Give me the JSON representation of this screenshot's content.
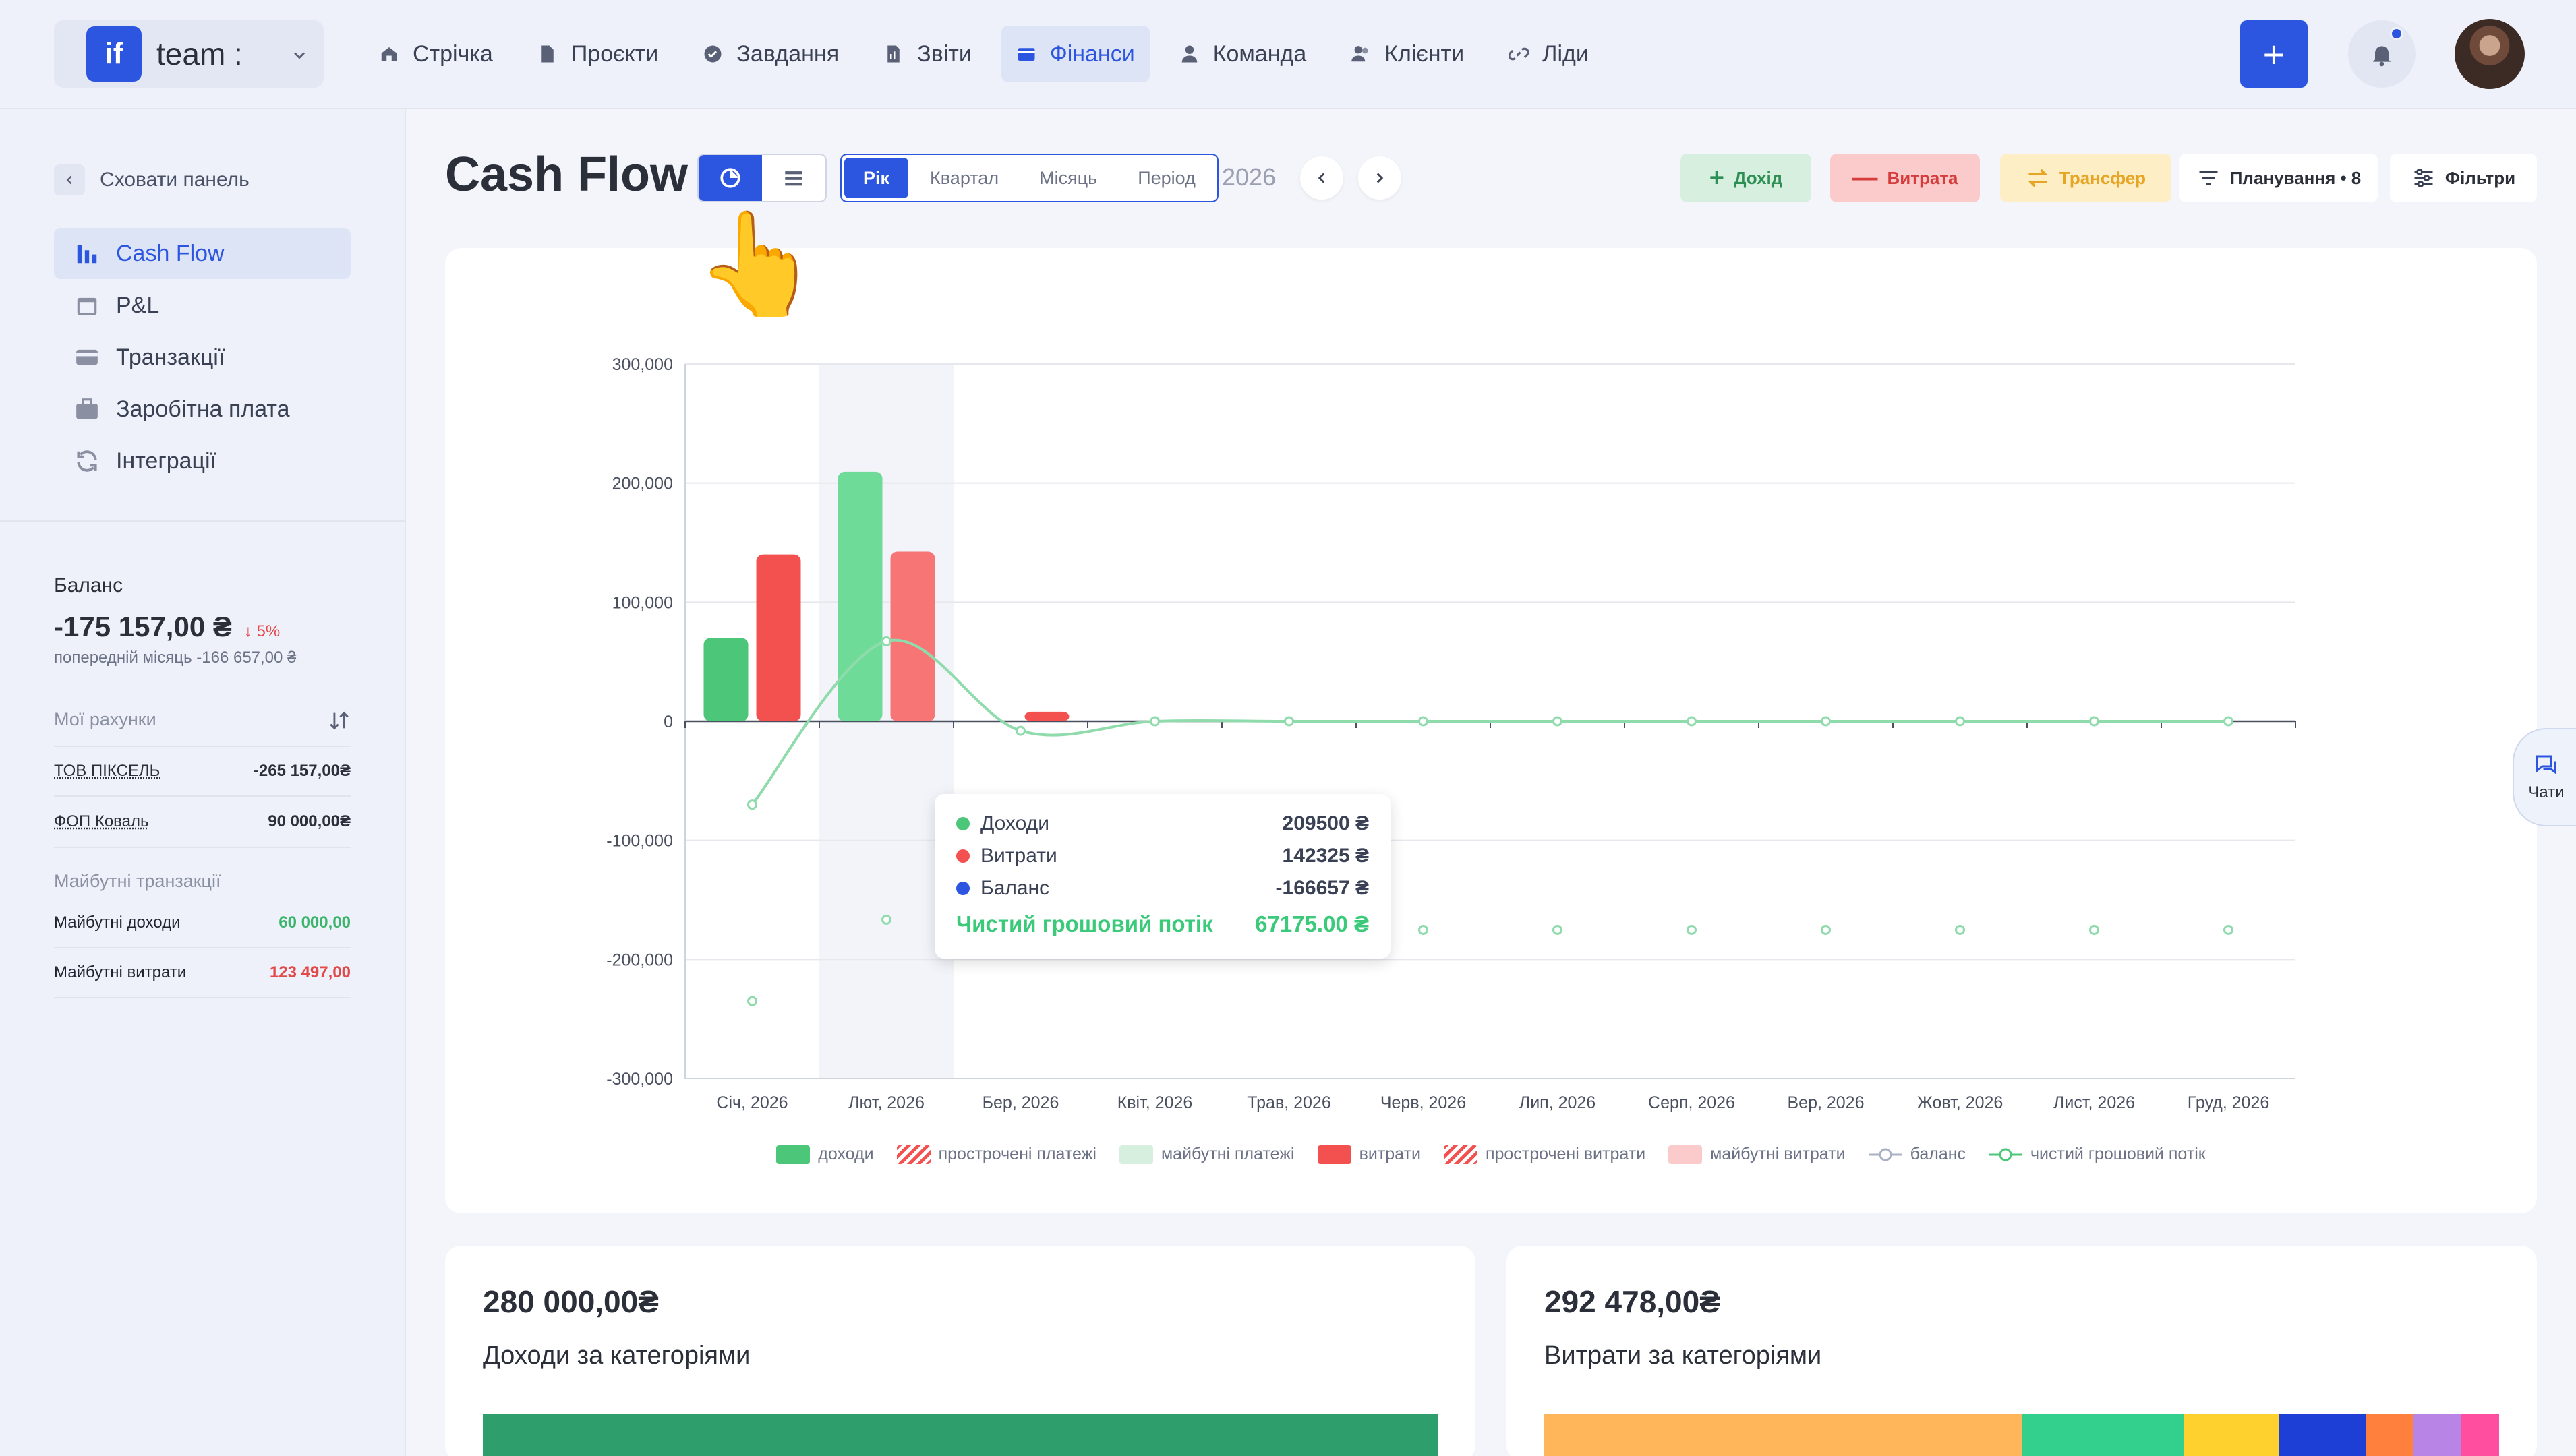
{
  "brand": {
    "logo": "if",
    "name": "team :"
  },
  "nav": [
    {
      "label": "Стрічка",
      "icon": "home-icon"
    },
    {
      "label": "Проєкти",
      "icon": "file-icon"
    },
    {
      "label": "Завдання",
      "icon": "check-circle-icon"
    },
    {
      "label": "Звіти",
      "icon": "report-icon"
    },
    {
      "label": "Фінанси",
      "icon": "wallet-icon",
      "active": true
    },
    {
      "label": "Команда",
      "icon": "user-icon"
    },
    {
      "label": "Клієнти",
      "icon": "users-icon"
    },
    {
      "label": "Ліди",
      "icon": "link-icon"
    }
  ],
  "topbar": {
    "plus": "+"
  },
  "sidebar": {
    "hide_label": "Сховати панель",
    "items": [
      {
        "label": "Cash Flow",
        "active": true
      },
      {
        "label": "P&L"
      },
      {
        "label": "Транзакції"
      },
      {
        "label": "Заробітна плата"
      },
      {
        "label": "Інтеграції"
      }
    ],
    "balance": {
      "title": "Баланс",
      "value": "-175 157,00 ₴",
      "change": "5%",
      "prev": "попередній місяць -166 657,00 ₴"
    },
    "accounts_title": "Мої рахунки",
    "accounts": [
      {
        "name": "ТОВ ПІКСЕЛЬ",
        "value": "-265 157,00₴"
      },
      {
        "name": "ФОП Коваль",
        "value": "90 000,00₴"
      }
    ],
    "future_title": "Майбутні транзакції",
    "future": [
      {
        "name": "Майбутні доходи",
        "value": "60 000,00"
      },
      {
        "name": "Майбутні витрати",
        "value": "123 497,00"
      }
    ]
  },
  "page": {
    "title": "Cash Flow",
    "period_tabs": [
      "Рік",
      "Квартал",
      "Місяць",
      "Період"
    ],
    "year": "2026",
    "actions": {
      "income": "Дохід",
      "expense": "Витрата",
      "transfer": "Трансфер",
      "planning": "Планування • 8",
      "filters": "Фільтри"
    },
    "hand": "👆"
  },
  "colors": {
    "accent": "#2d56e0",
    "income": "#4cc779",
    "expense": "#f35050",
    "balance": "#3f6ff0",
    "netflow": "#3bc97a"
  },
  "chart_data": {
    "type": "bar",
    "categories": [
      "Січ, 2026",
      "Лют, 2026",
      "Бер, 2026",
      "Квіт, 2026",
      "Трав, 2026",
      "Черв, 2026",
      "Лип, 2026",
      "Серп, 2026",
      "Вер, 2026",
      "Жовт, 2026",
      "Лист, 2026",
      "Груд, 2026"
    ],
    "ylim": [
      -300000,
      300000
    ],
    "yticks": [
      300000,
      200000,
      100000,
      0,
      -100000,
      -200000,
      -300000
    ],
    "ytick_labels": [
      "300,000",
      "200,000",
      "100,000",
      "0",
      "-100,000",
      "-200,000",
      "-300,000"
    ],
    "highlight_index": 1,
    "series": [
      {
        "name": "доходи",
        "type": "bar",
        "values": [
          70000,
          209500,
          0,
          0,
          0,
          0,
          0,
          0,
          0,
          0,
          0,
          0
        ]
      },
      {
        "name": "витрати",
        "type": "bar",
        "values": [
          140000,
          142325,
          8000,
          0,
          0,
          0,
          0,
          0,
          0,
          0,
          0,
          0
        ]
      },
      {
        "name": "баланс",
        "type": "scatter",
        "values": [
          -235000,
          -166657,
          null,
          null,
          null,
          -175157,
          -175157,
          -175157,
          -175157,
          -175157,
          -175157,
          -175157
        ]
      },
      {
        "name": "чистий грошовий потік",
        "type": "line",
        "values": [
          -70000,
          67175,
          -8000,
          0,
          0,
          0,
          0,
          0,
          0,
          0,
          0,
          0
        ]
      }
    ],
    "legend": [
      {
        "label": "доходи",
        "style": "solid",
        "color": "#4cc779"
      },
      {
        "label": "прострочені платежі",
        "style": "hatch",
        "color": "#f35050"
      },
      {
        "label": "майбутні платежі",
        "style": "solid",
        "color": "#d6efde"
      },
      {
        "label": "витрати",
        "style": "solid",
        "color": "#f35050"
      },
      {
        "label": "прострочені витрати",
        "style": "hatch",
        "color": "#f35050"
      },
      {
        "label": "майбутні витрати",
        "style": "solid",
        "color": "#fbcaca"
      },
      {
        "label": "баланс",
        "style": "line",
        "color": "#a9b2c2"
      },
      {
        "label": "чистий грошовий потік",
        "style": "line",
        "color": "#4cc779"
      }
    ],
    "tooltip": {
      "rows": [
        {
          "label": "Доходи",
          "value": "209500 ₴",
          "color": "#4cc779"
        },
        {
          "label": "Витрати",
          "value": "142325 ₴",
          "color": "#f35050"
        },
        {
          "label": "Баланс",
          "value": "-166657 ₴",
          "color": "#2d56e0"
        }
      ],
      "total_label": "Чистий грошовий потік",
      "total_value": "67175.00 ₴"
    }
  },
  "chat": {
    "label": "Чати"
  },
  "bottom": {
    "income": {
      "amount": "280 000,00₴",
      "caption": "Доходи за категоріями",
      "segments": [
        {
          "share": 1.0,
          "color": "#2f9e6d"
        }
      ]
    },
    "expense": {
      "amount": "292 478,00₴",
      "caption": "Витрати за категоріями",
      "segments": [
        {
          "share": 0.5,
          "color": "#ffb55a"
        },
        {
          "share": 0.17,
          "color": "#33cf8c"
        },
        {
          "share": 0.1,
          "color": "#ffd12e"
        },
        {
          "share": 0.09,
          "color": "#1d3fd6"
        },
        {
          "share": 0.05,
          "color": "#ff7f3c"
        },
        {
          "share": 0.05,
          "color": "#b884e6"
        },
        {
          "share": 0.04,
          "color": "#ff4ea0"
        }
      ]
    }
  }
}
